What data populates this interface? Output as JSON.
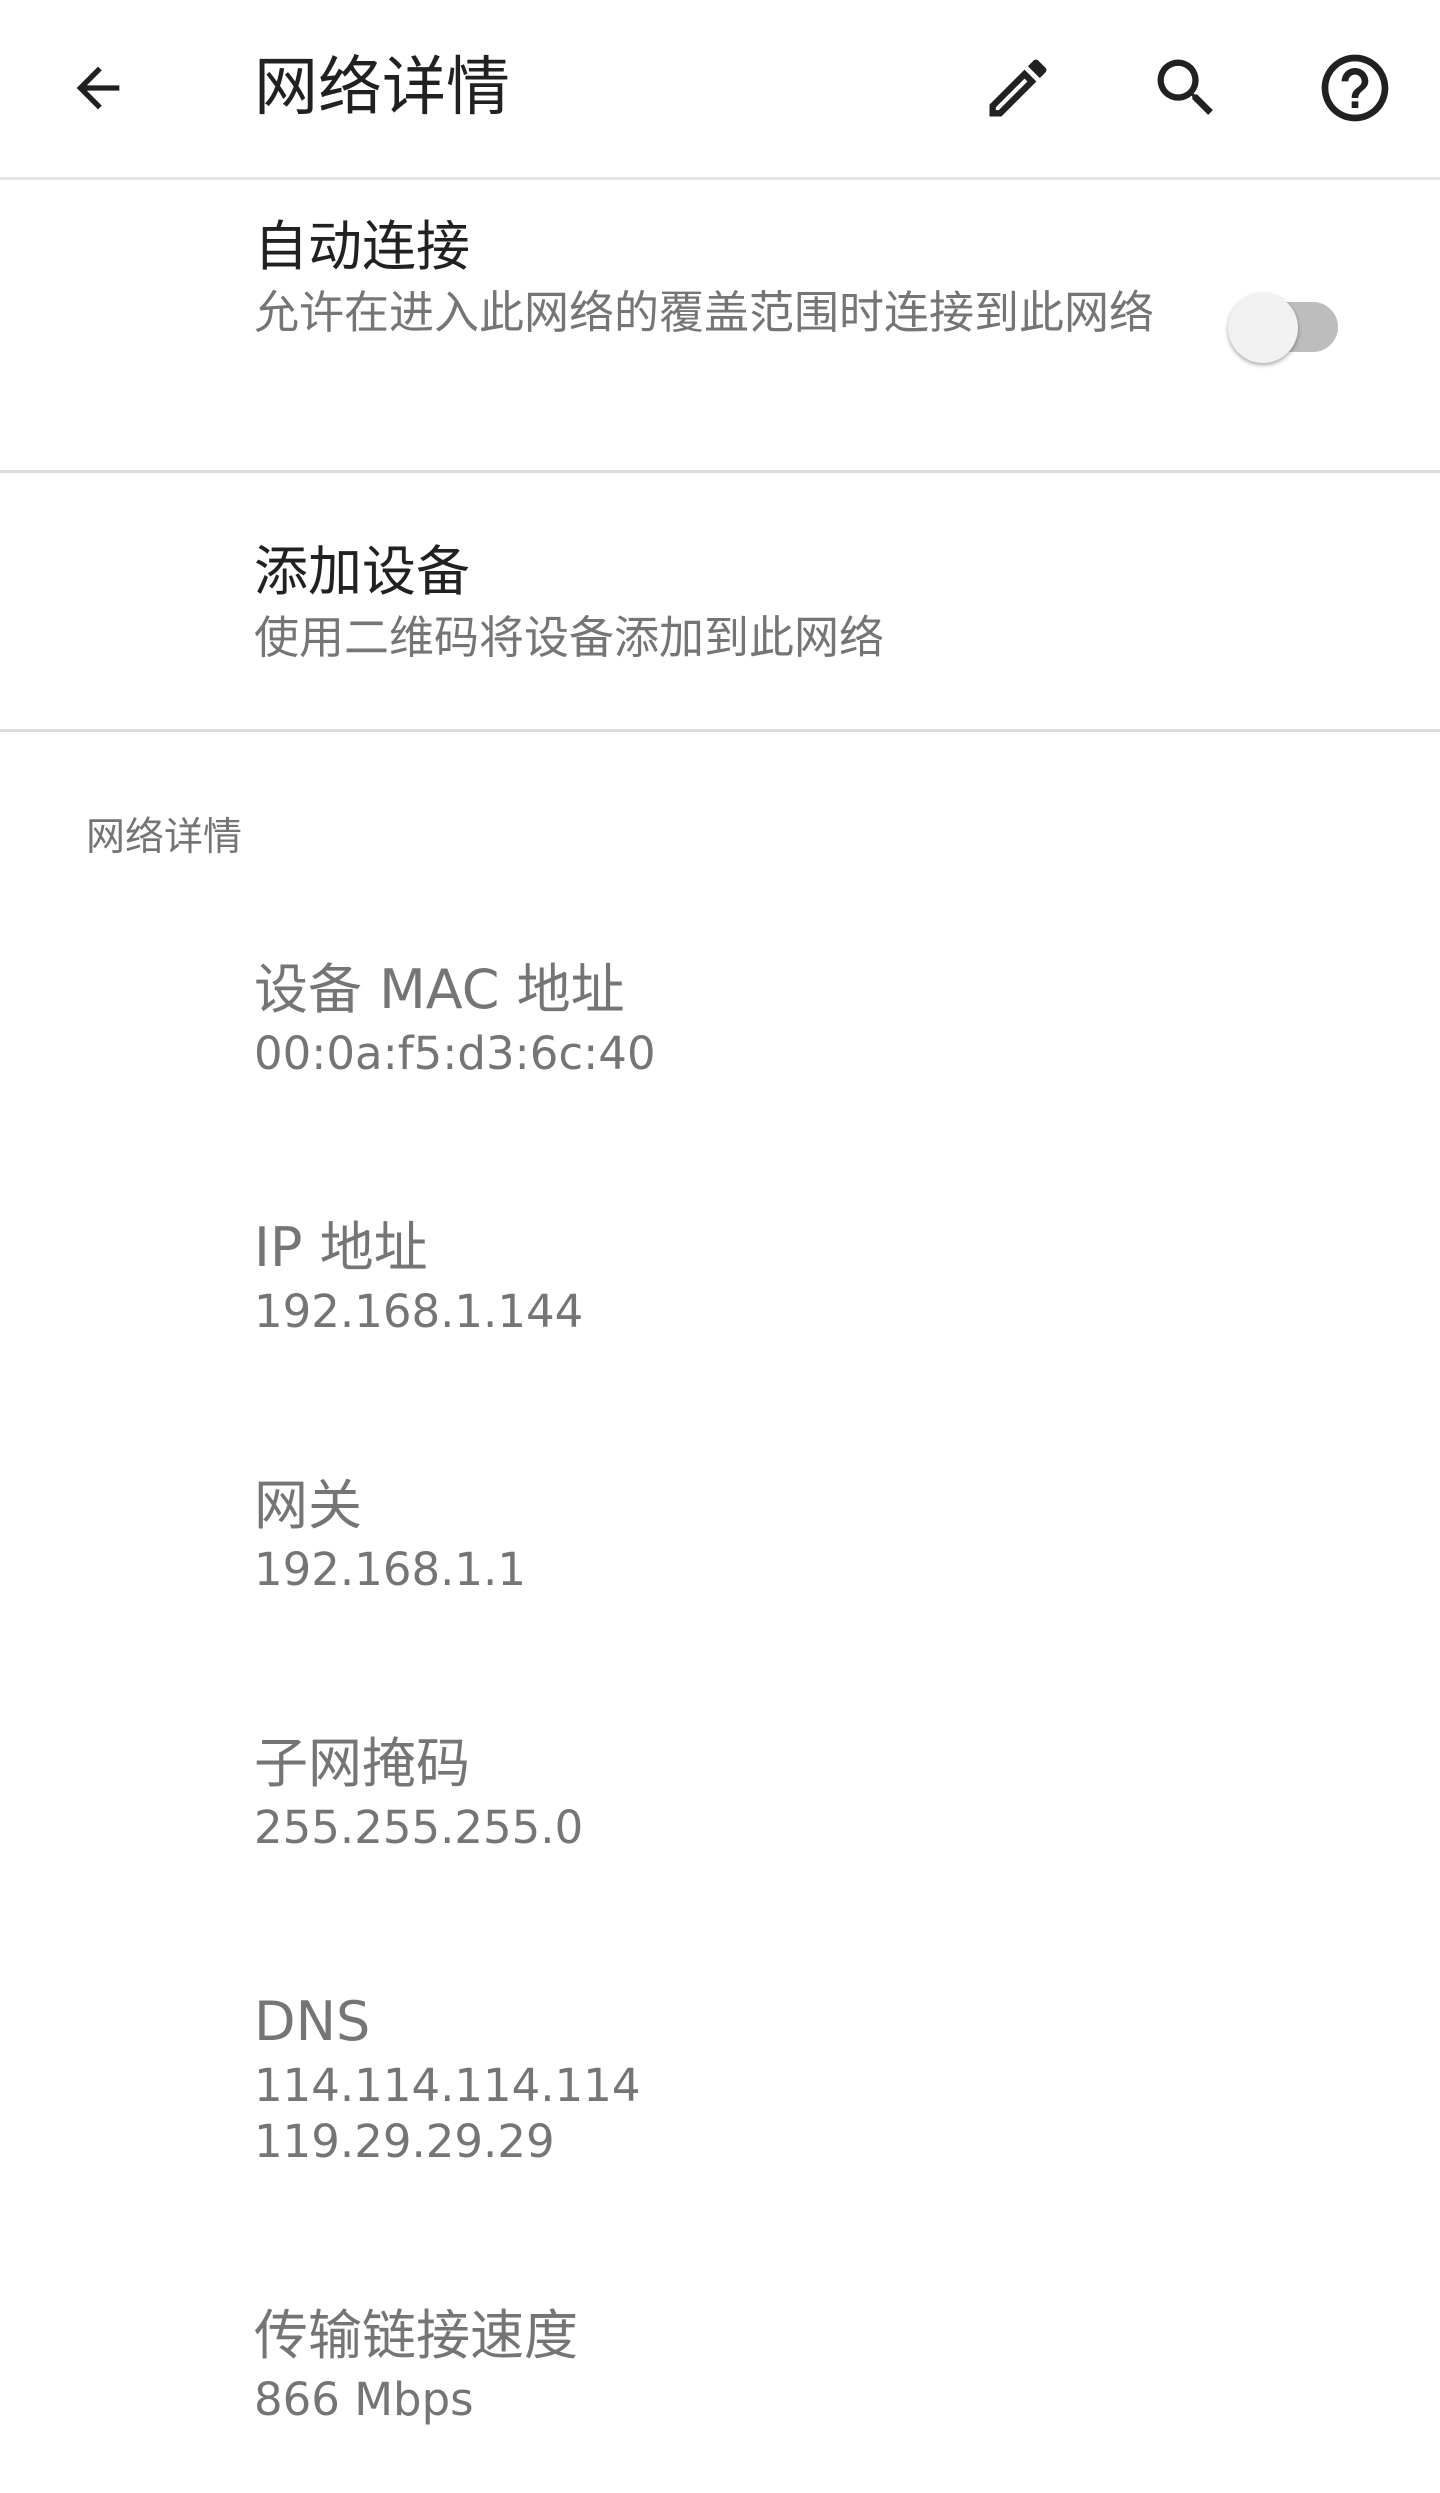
{
  "appbar": {
    "title": "网络详情",
    "back_icon": "arrow-back-icon",
    "edit_icon": "pencil-icon",
    "search_icon": "search-icon",
    "help_icon": "help-circle-icon"
  },
  "auto_connect": {
    "title": "自动连接",
    "summary": "允许在进入此网络的覆盖范围时连接到此网络",
    "enabled": false
  },
  "add_device": {
    "title": "添加设备",
    "summary": "使用二维码将设备添加到此网络"
  },
  "details_section": {
    "header": "网络详情",
    "mac": {
      "label": "设备 MAC 地址",
      "value": "00:0a:f5:d3:6c:40"
    },
    "ip": {
      "label": "IP 地址",
      "value": "192.168.1.144"
    },
    "gateway": {
      "label": "网关",
      "value": "192.168.1.1"
    },
    "subnet": {
      "label": "子网掩码",
      "value": "255.255.255.0"
    },
    "dns": {
      "label": "DNS",
      "values": [
        "114.114.114.114",
        "119.29.29.29"
      ]
    },
    "link_speed": {
      "label": "传输链接速度",
      "value": "866 Mbps"
    }
  },
  "colors": {
    "primary_text": "#212121",
    "secondary_text": "#757575",
    "divider": "#dcdcdc",
    "toggle_track_off": "#bdbdbd",
    "toggle_thumb_off": "#f1f1f1"
  }
}
